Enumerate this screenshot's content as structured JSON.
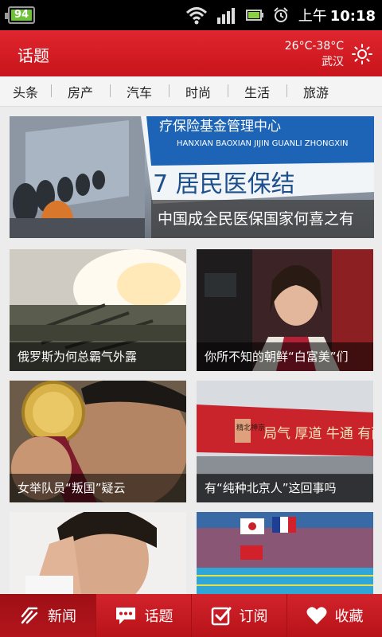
{
  "status": {
    "battery_level": "94",
    "time_period": "上午",
    "time": "10:18"
  },
  "header": {
    "title": "话题",
    "temperature": "26°C-38°C",
    "city": "武汉"
  },
  "tabs": [
    "头条",
    "房产",
    "汽车",
    "时尚",
    "生活",
    "旅游"
  ],
  "cards": [
    {
      "caption": "中国成全民医保国家何喜之有"
    },
    {
      "caption": "俄罗斯为何总霸气外露"
    },
    {
      "caption": "你所不知的朝鲜“白富美”们"
    },
    {
      "caption": "女举队员“叛国”疑云"
    },
    {
      "caption": "有“纯种北京人”这回事吗"
    },
    {
      "caption": ""
    },
    {
      "caption": ""
    }
  ],
  "photo_text": {
    "sign_pinyin": "HANXIAN BAOXIAN JIJIN GUANLI ZHONGXIN",
    "sign_chinese": "疗保险基金管理中心",
    "sign_banner": "7 居民医保结",
    "banner_text": "局气 厚道 牛通 有面儿",
    "banner_side": "精北神京"
  },
  "bottom_nav": [
    {
      "label": "新闻",
      "icon": "news-icon"
    },
    {
      "label": "话题",
      "icon": "topic-icon"
    },
    {
      "label": "订阅",
      "icon": "subscribe-icon"
    },
    {
      "label": "收藏",
      "icon": "favorite-icon"
    }
  ],
  "colors": {
    "brand_red": "#d11d24",
    "tab_bg": "#f4f4f4"
  }
}
